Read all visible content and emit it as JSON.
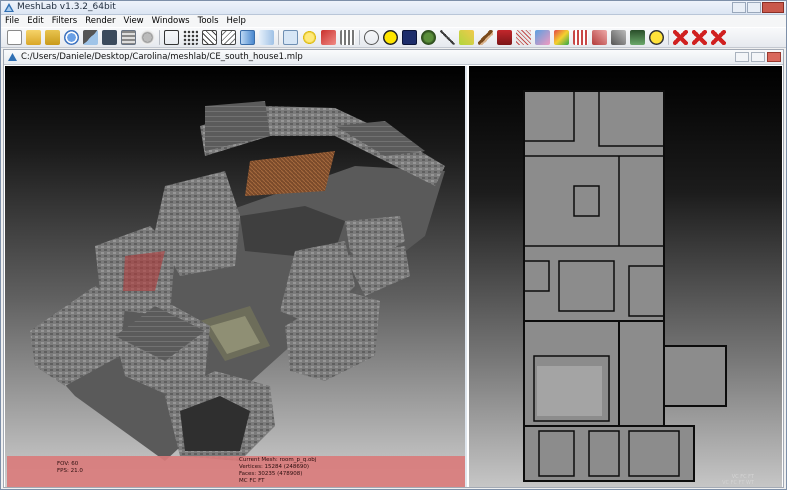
{
  "window": {
    "title": "MeshLab v1.3.2_64bit"
  },
  "menu": [
    "File",
    "Edit",
    "Filters",
    "Render",
    "View",
    "Windows",
    "Tools",
    "Help"
  ],
  "toolbar": {
    "icons": [
      "new-icon",
      "open-icon",
      "save-icon",
      "reload-icon",
      "import-icon",
      "snapshot-icon",
      "layers-icon",
      "raster-icon",
      "bbox-icon",
      "points-icon",
      "wireframe-icon",
      "hidden-lines-icon",
      "flat-icon",
      "smooth-icon",
      "texture-icon",
      "light-icon",
      "backface-icon",
      "trackball-icon",
      "annotate-icon",
      "color-icon",
      "selection-icon",
      "paint-icon",
      "measure-icon",
      "align-icon",
      "brush-icon",
      "pickpoints-icon",
      "reference-icon",
      "scale-icon",
      "info-icon",
      "delete-vertices-icon",
      "delete-faces-icon",
      "delete-selection-icon"
    ]
  },
  "document": {
    "path": "C:/Users/Daniele/Desktop/Carolina/meshlab/CE_south_house1.mlp"
  },
  "info": {
    "fov": "FOV: 60",
    "fps": "FPS:   21.0",
    "current_mesh": "Current Mesh: room_p_q.obj",
    "vertices": "Vertices: 15284 (248690)",
    "faces": "Faces: 30235 (478908)",
    "extra": "MC FC FT",
    "right_line1": "VC FC FT",
    "right_line2": "VC FC FT WT"
  },
  "colors": {
    "accent_close": "#c9584b",
    "info_bar": "#d97a7a"
  }
}
